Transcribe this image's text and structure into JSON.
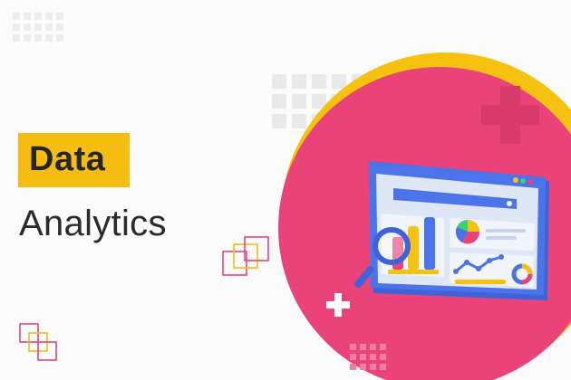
{
  "banner": {
    "title_highlight": "Data",
    "subtitle": "Analytics"
  },
  "colors": {
    "background": "#fbfbfb",
    "highlight": "#f5bd10",
    "circle": "#e9437a",
    "ring": "#f6c10f",
    "text": "#2b2b2b"
  },
  "illustration": {
    "description_icons": [
      "dashboard-window-icon",
      "bar-chart-icon",
      "pie-chart-icon",
      "line-chart-icon",
      "donut-chart-icon",
      "magnifier-icon",
      "plus-icon"
    ]
  }
}
